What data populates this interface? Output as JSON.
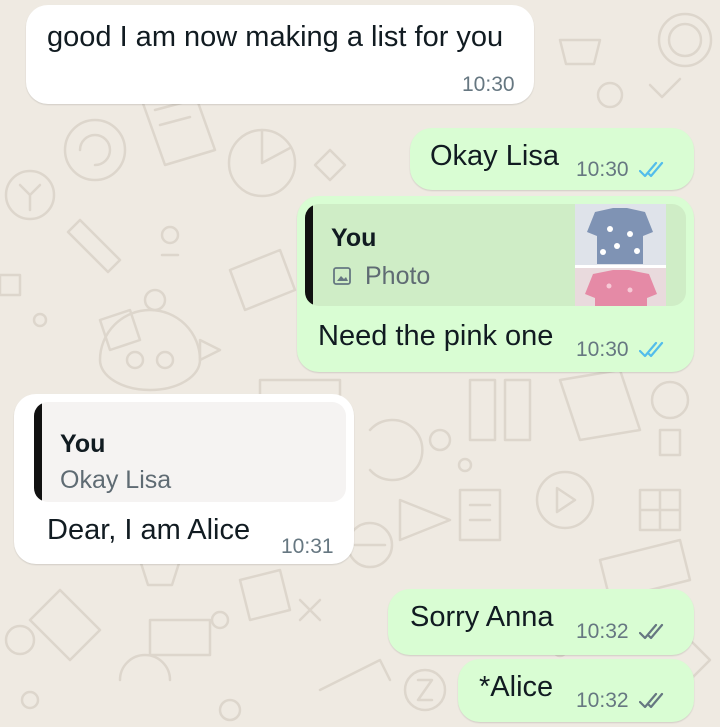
{
  "colors": {
    "wallpaper": "#efeae2",
    "incoming_bubble": "#ffffff",
    "outgoing_bubble": "#d9fdd3",
    "read_ticks": "#53bdeb",
    "delivered_ticks": "#667781"
  },
  "messages": [
    {
      "direction": "incoming",
      "text": "good I am now making a list for you",
      "time": "10:30"
    },
    {
      "direction": "outgoing",
      "text": "Okay Lisa",
      "time": "10:30",
      "status": "read"
    },
    {
      "direction": "outgoing",
      "reply": {
        "author": "You",
        "type_icon": "photo-icon",
        "text": "Photo"
      },
      "text": "Need the pink one",
      "time": "10:30",
      "status": "read"
    },
    {
      "direction": "incoming",
      "reply": {
        "author": "You",
        "text": "Okay Lisa"
      },
      "text": "Dear, I am Alice",
      "time": "10:31"
    },
    {
      "direction": "outgoing",
      "text": "Sorry Anna",
      "time": "10:32",
      "status": "delivered"
    },
    {
      "direction": "outgoing",
      "text": "*Alice",
      "time": "10:32",
      "status": "delivered"
    }
  ]
}
